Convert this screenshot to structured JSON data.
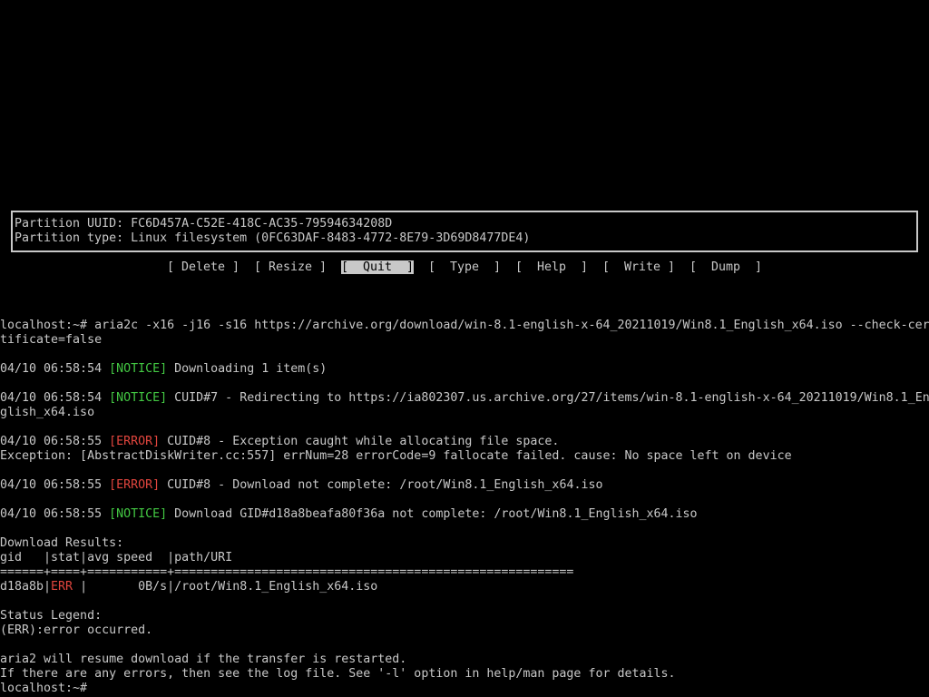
{
  "partition": {
    "uuid_line": "Partition UUID: FC6D457A-C52E-418C-AC35-79594634208D",
    "type_line": "Partition type: Linux filesystem (0FC63DAF-8483-4772-8E79-3D69D8477DE4)"
  },
  "menu": {
    "items": [
      "[ Delete ]",
      "[ Resize ]",
      "[  Quit  ]",
      "[  Type  ]",
      "[  Help  ]",
      "[  Write ]",
      "[  Dump  ]"
    ],
    "selected": "Quit"
  },
  "terminal": {
    "cmd1": "localhost:~# aria2c -x16 -j16 -s16 https://archive.org/download/win-8.1-english-x-64_20211019/Win8.1_English_x64.iso --check-cer",
    "cmd1_wrap": "tificate=false",
    "l1_time": "04/10 06:58:54 ",
    "l1_tag": "[NOTICE]",
    "l1_msg": " Downloading 1 item(s)",
    "l2_time": "04/10 06:58:54 ",
    "l2_tag": "[NOTICE]",
    "l2_msg": " CUID#7 - Redirecting to https://ia802307.us.archive.org/27/items/win-8.1-english-x-64_20211019/Win8.1_En",
    "l2_wrap": "glish_x64.iso",
    "l3_time": "04/10 06:58:55 ",
    "l3_tag": "[ERROR]",
    "l3_msg": " CUID#8 - Exception caught while allocating file space.",
    "l3_exc": "Exception: [AbstractDiskWriter.cc:557] errNum=28 errorCode=9 fallocate failed. cause: No space left on device",
    "l4_time": "04/10 06:58:55 ",
    "l4_tag": "[ERROR]",
    "l4_msg": " CUID#8 - Download not complete: /root/Win8.1_English_x64.iso",
    "l5_time": "04/10 06:58:55 ",
    "l5_tag": "[NOTICE]",
    "l5_msg": " Download GID#d18a8beafa80f36a not complete: /root/Win8.1_English_x64.iso",
    "results_title": "Download Results:",
    "results_header": "gid   |stat|avg speed  |path/URI",
    "results_rule": "======+====+===========+=======================================================",
    "row_gid": "d18a8b|",
    "row_stat": "ERR",
    "row_rest": " |       0B/s|/root/Win8.1_English_x64.iso",
    "legend_title": "Status Legend:",
    "legend_err": "(ERR):error occurred.",
    "resume_msg": "aria2 will resume download if the transfer is restarted.",
    "errors_msg": "If there are any errors, then see the log file. See '-l' option in help/man page for details.",
    "prompt": "localhost:~#"
  }
}
